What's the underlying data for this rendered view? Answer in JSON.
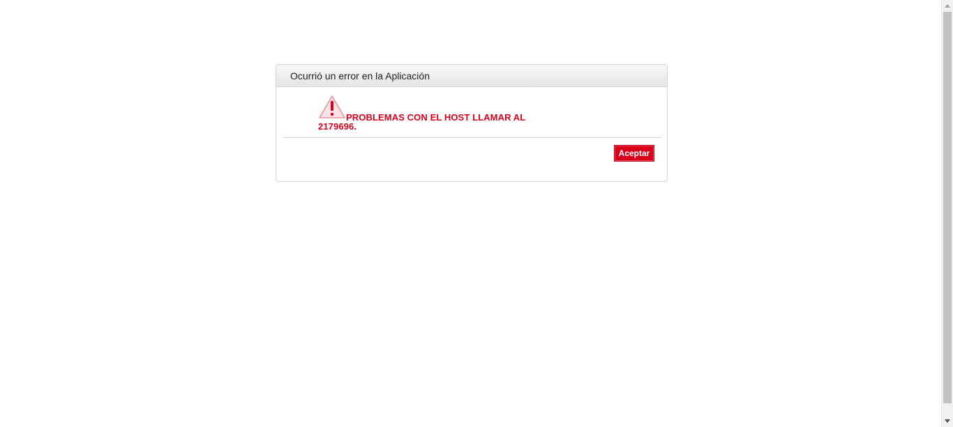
{
  "dialog": {
    "title": "Ocurrió un error en la Aplicación",
    "message": "PROBLEMAS CON EL HOST LLAMAR AL 2179696.",
    "icon": "warning-icon",
    "accept_label": "Aceptar"
  },
  "colors": {
    "accent": "#d9001b",
    "header_bg": "#ececec",
    "border": "#d4d4d4"
  }
}
